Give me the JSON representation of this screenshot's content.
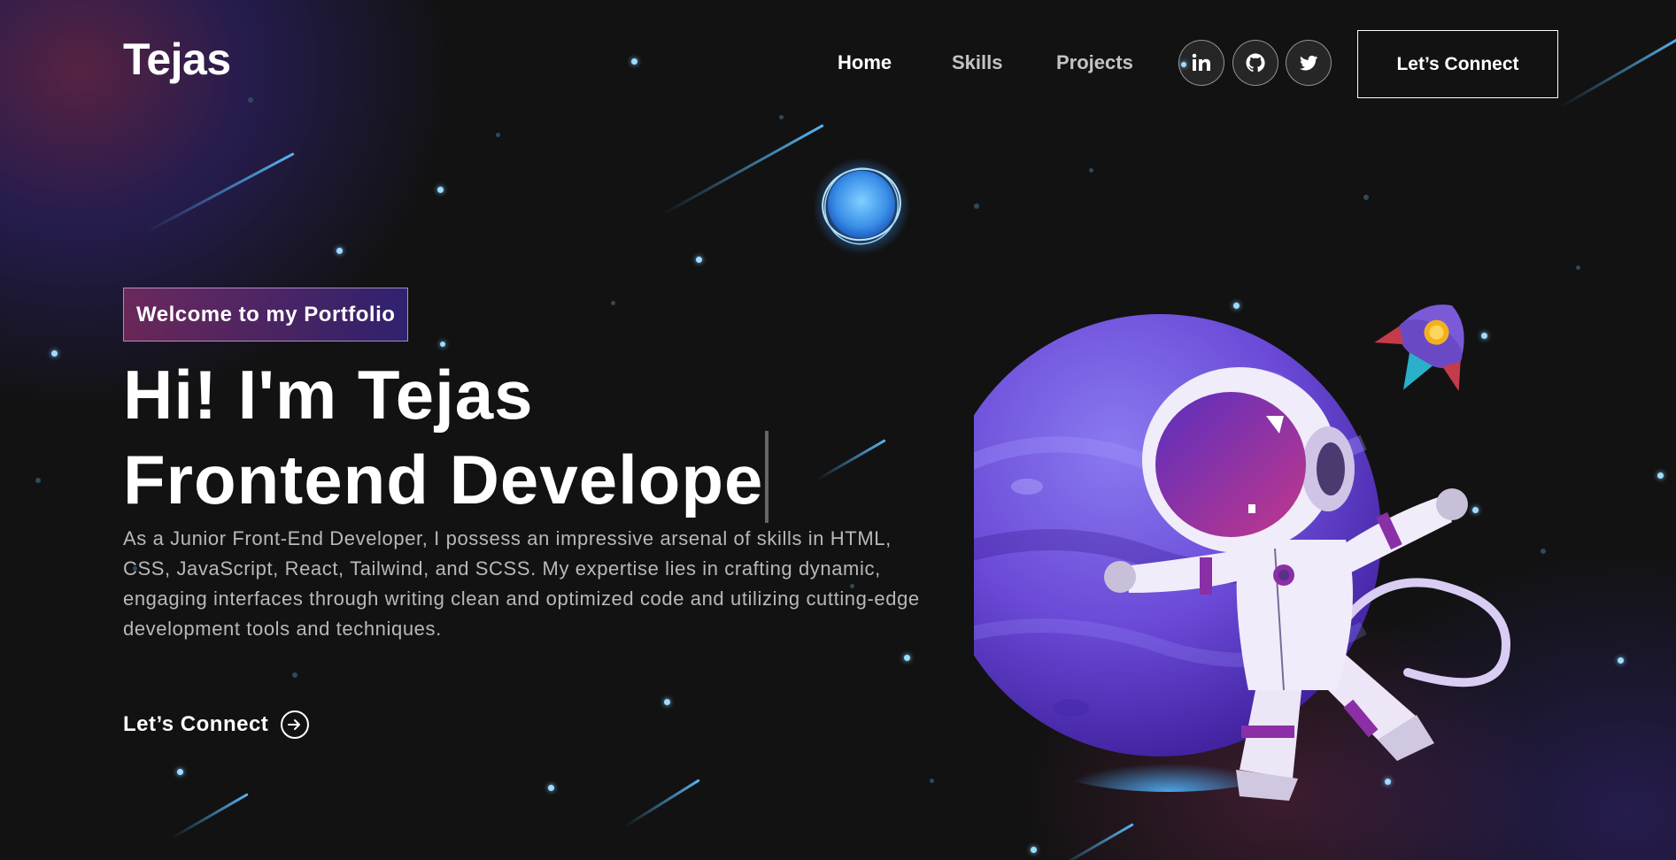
{
  "nav": {
    "logo": "Tejas",
    "links": [
      {
        "label": "Home",
        "active": true
      },
      {
        "label": "Skills",
        "active": false
      },
      {
        "label": "Projects",
        "active": false
      }
    ],
    "socials": [
      {
        "name": "linkedin",
        "icon": "linkedin-icon"
      },
      {
        "name": "github",
        "icon": "github-icon"
      },
      {
        "name": "twitter",
        "icon": "twitter-icon"
      }
    ],
    "connect_label": "Let’s Connect"
  },
  "hero": {
    "tagline": "Welcome to my Portfolio",
    "headline_line1": "Hi! I'm Tejas",
    "headline_line2": "Frontend Develope",
    "description": "As a Junior Front-End Developer, I possess an impressive arsenal of skills in HTML, CSS, JavaScript, React, Tailwind, and SCSS. My expertise lies in crafting dynamic, engaging interfaces through writing clean and optimized code and utilizing cutting-edge development tools and techniques.",
    "cta_label": "Let’s Connect"
  },
  "colors": {
    "background": "#121212",
    "accent_pink": "#AA367C",
    "accent_purple": "#4A2FBD",
    "text_muted": "#B8B8B8"
  }
}
